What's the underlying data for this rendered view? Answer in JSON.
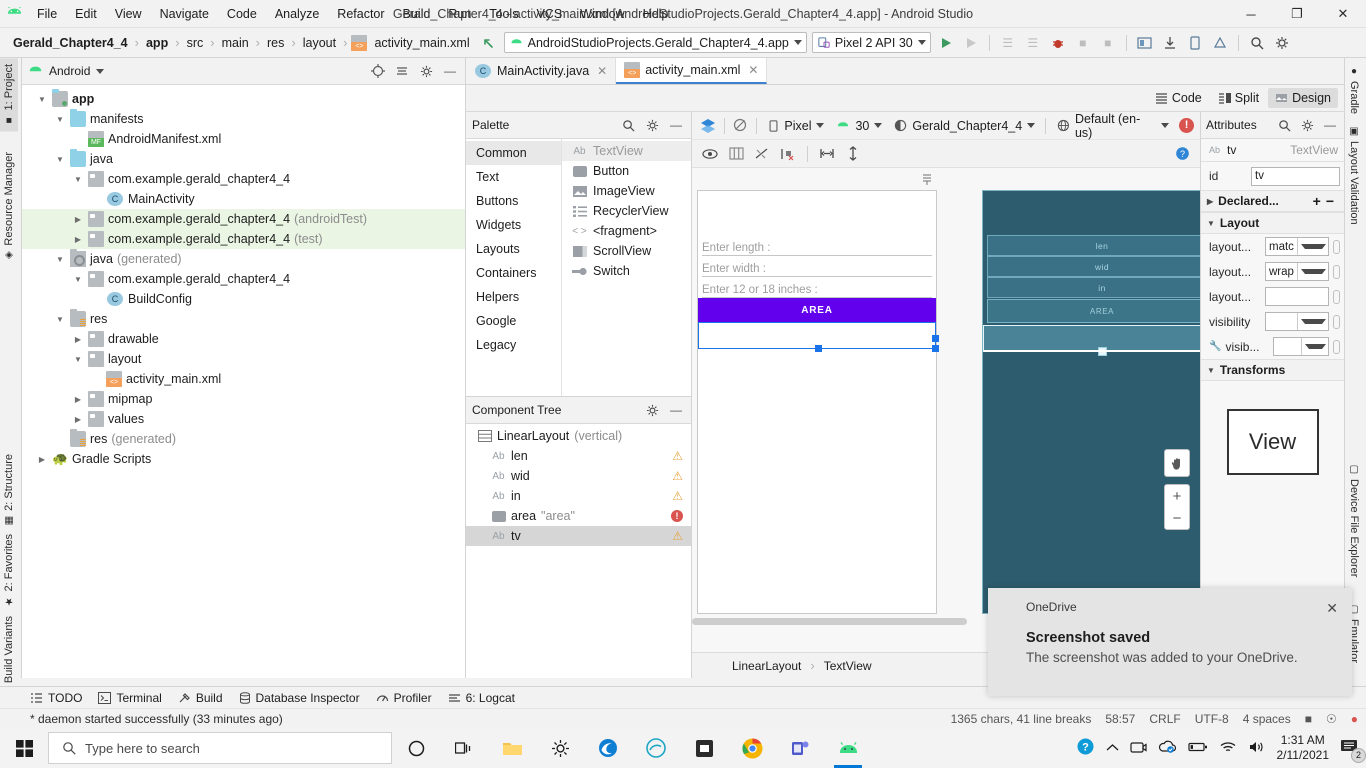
{
  "window": {
    "title": "Gerald_Chapter4_4 - activity_main.xml [AndroidStudioProjects.Gerald_Chapter4_4.app] - Android Studio",
    "minimize": "─",
    "maximize": "❐",
    "close": "✕"
  },
  "menubar": {
    "logo_icon": "android-logo",
    "items": [
      "File",
      "Edit",
      "View",
      "Navigate",
      "Code",
      "Analyze",
      "Refactor",
      "Build",
      "Run",
      "Tools",
      "VCS",
      "Window",
      "Help"
    ]
  },
  "breadcrumb": {
    "items": [
      "Gerald_Chapter4_4",
      "app",
      "src",
      "main",
      "res",
      "layout",
      "activity_main.xml"
    ],
    "separator": "›"
  },
  "toolbar": {
    "back_icon": "back-arrow-icon",
    "module_config": "AndroidStudioProjects.Gerald_Chapter4_4.app",
    "device_config": "Pixel 2 API 30",
    "run_icon": "run-icon",
    "debug_icon": "debug-icon",
    "icons": [
      "run-icon",
      "rerun-icon",
      "step-over-icon",
      "step-into-icon",
      "bug-icon",
      "stop-icon",
      "layout-inspector-icon",
      "apply-changes-icon",
      "avd-manager-icon",
      "sdk-manager-icon",
      "profiler-icon",
      "search-icon",
      "settings-icon"
    ]
  },
  "left_strip": {
    "tabs": [
      {
        "label": "1: Project",
        "icon": "project-icon",
        "active": true
      },
      {
        "label": "Resource Manager",
        "icon": "resource-icon",
        "active": false
      }
    ],
    "bottom_tabs": [
      {
        "label": "2: Structure",
        "icon": "structure-icon"
      },
      {
        "label": "2: Favorites",
        "icon": "star-icon"
      },
      {
        "label": "Build Variants",
        "icon": "android-icon"
      }
    ]
  },
  "right_strip": {
    "tabs": [
      {
        "label": "Gradle",
        "icon": "gradle-icon"
      },
      {
        "label": "Layout Validation",
        "icon": "layout-validation-icon"
      },
      {
        "label": "Device File Explorer",
        "icon": "device-file-icon"
      },
      {
        "label": "Emulator",
        "icon": "emulator-icon"
      }
    ]
  },
  "project_panel": {
    "title": "Android",
    "dropdown_icon": "chevron-down-icon",
    "header_icons": [
      "target-icon",
      "collapse-all-icon",
      "settings-icon",
      "minimize-icon"
    ],
    "tree": [
      {
        "depth": 0,
        "arrow": "open",
        "icon": "folder-app",
        "label": "app",
        "bold": true,
        "dim": "",
        "highlight": false
      },
      {
        "depth": 1,
        "arrow": "open",
        "icon": "folder-blue",
        "label": "manifests",
        "bold": false,
        "dim": "",
        "highlight": false
      },
      {
        "depth": 2,
        "arrow": "none",
        "icon": "manifest-file",
        "label": "AndroidManifest.xml",
        "bold": false,
        "dim": "",
        "highlight": false
      },
      {
        "depth": 1,
        "arrow": "open",
        "icon": "folder-blue",
        "label": "java",
        "bold": false,
        "dim": "",
        "highlight": false
      },
      {
        "depth": 2,
        "arrow": "open",
        "icon": "package",
        "label": "com.example.gerald_chapter4_4",
        "bold": false,
        "dim": "",
        "highlight": false
      },
      {
        "depth": 3,
        "arrow": "none",
        "icon": "class",
        "label": "MainActivity",
        "bold": false,
        "dim": "",
        "highlight": false
      },
      {
        "depth": 2,
        "arrow": "closed",
        "icon": "package",
        "label": "com.example.gerald_chapter4_4",
        "bold": false,
        "dim": "(androidTest)",
        "highlight": true
      },
      {
        "depth": 2,
        "arrow": "closed",
        "icon": "package",
        "label": "com.example.gerald_chapter4_4",
        "bold": false,
        "dim": "(test)",
        "highlight": true
      },
      {
        "depth": 1,
        "arrow": "open",
        "icon": "folder-generated",
        "label": "java",
        "bold": false,
        "dim": "(generated)",
        "highlight": false
      },
      {
        "depth": 2,
        "arrow": "open",
        "icon": "package",
        "label": "com.example.gerald_chapter4_4",
        "bold": false,
        "dim": "",
        "highlight": false
      },
      {
        "depth": 3,
        "arrow": "none",
        "icon": "class",
        "label": "BuildConfig",
        "bold": false,
        "dim": "",
        "highlight": false
      },
      {
        "depth": 1,
        "arrow": "open",
        "icon": "folder-res",
        "label": "res",
        "bold": false,
        "dim": "",
        "highlight": false
      },
      {
        "depth": 2,
        "arrow": "closed",
        "icon": "package",
        "label": "drawable",
        "bold": false,
        "dim": "",
        "highlight": false
      },
      {
        "depth": 2,
        "arrow": "open",
        "icon": "package",
        "label": "layout",
        "bold": false,
        "dim": "",
        "highlight": false
      },
      {
        "depth": 3,
        "arrow": "none",
        "icon": "xml-file",
        "label": "activity_main.xml",
        "bold": false,
        "dim": "",
        "highlight": false
      },
      {
        "depth": 2,
        "arrow": "closed",
        "icon": "package",
        "label": "mipmap",
        "bold": false,
        "dim": "",
        "highlight": false
      },
      {
        "depth": 2,
        "arrow": "closed",
        "icon": "package",
        "label": "values",
        "bold": false,
        "dim": "",
        "highlight": false
      },
      {
        "depth": 1,
        "arrow": "none",
        "icon": "folder-res",
        "label": "res",
        "bold": false,
        "dim": "(generated)",
        "highlight": false
      },
      {
        "depth": 0,
        "arrow": "closed",
        "icon": "gradle",
        "label": "Gradle Scripts",
        "bold": false,
        "dim": "",
        "highlight": false
      }
    ]
  },
  "editor": {
    "tabs": [
      {
        "label": "MainActivity.java",
        "icon": "java-class-icon",
        "active": false,
        "close": "✕"
      },
      {
        "label": "activity_main.xml",
        "icon": "xml-layout-icon",
        "active": true,
        "close": "✕"
      }
    ],
    "modes": [
      {
        "label": "Code",
        "icon": "code-icon",
        "active": false
      },
      {
        "label": "Split",
        "icon": "split-icon",
        "active": false
      },
      {
        "label": "Design",
        "icon": "design-icon",
        "active": true
      }
    ]
  },
  "palette": {
    "title": "Palette",
    "header_icons": [
      "search-icon",
      "settings-icon",
      "minimize-icon"
    ],
    "categories": [
      "Common",
      "Text",
      "Buttons",
      "Widgets",
      "Layouts",
      "Containers",
      "Helpers",
      "Google",
      "Legacy"
    ],
    "selected_category": "Common",
    "items": [
      {
        "label": "TextView",
        "icon": "textview-icon",
        "selected": true
      },
      {
        "label": "Button",
        "icon": "button-icon",
        "selected": false
      },
      {
        "label": "ImageView",
        "icon": "imageview-icon",
        "selected": false
      },
      {
        "label": "RecyclerView",
        "icon": "recyclerview-icon",
        "selected": false
      },
      {
        "label": "<fragment>",
        "icon": "fragment-icon",
        "selected": false
      },
      {
        "label": "ScrollView",
        "icon": "scrollview-icon",
        "selected": false
      },
      {
        "label": "Switch",
        "icon": "switch-icon",
        "selected": false
      }
    ]
  },
  "component_tree": {
    "title": "Component Tree",
    "header_icons": [
      "settings-icon",
      "minimize-icon"
    ],
    "rows": [
      {
        "label": "LinearLayout",
        "sub": "(vertical)",
        "icon": "linearlayout-icon",
        "status": "none",
        "selected": false
      },
      {
        "label": "len",
        "sub": "",
        "icon": "textview-icon",
        "status": "warning",
        "selected": false
      },
      {
        "label": "wid",
        "sub": "",
        "icon": "textview-icon",
        "status": "warning",
        "selected": false
      },
      {
        "label": "in",
        "sub": "",
        "icon": "textview-icon",
        "status": "warning",
        "selected": false
      },
      {
        "label": "area",
        "sub": "\"area\"",
        "icon": "button-icon",
        "status": "error",
        "selected": false
      },
      {
        "label": "tv",
        "sub": "",
        "icon": "textview-icon",
        "status": "warning",
        "selected": true
      }
    ]
  },
  "design_surface": {
    "toolbar_icons": [
      "design-blueprint-icon",
      "orientation-icon"
    ],
    "device": "Pixel",
    "api_level": "30",
    "theme": "Gerald_Chapter4_4",
    "locale": "Default (en-us)",
    "error_icon": "error-icon",
    "help_icon": "help-icon",
    "hamburger_icon": "hamburger-icon",
    "view_icons": [
      "eye-icon",
      "columns-icon",
      "no-constraints-icon",
      "clear-constraints-icon",
      "pack-icon",
      "baseline-align-icon"
    ],
    "pan_icon": "pan-hand-icon",
    "zoom_in": "+",
    "zoom_out": "−",
    "preview": {
      "fields": [
        "Enter length :",
        "Enter width :",
        "Enter 12 or 18 inches :"
      ],
      "button": "AREA",
      "selected_widget": "tv"
    },
    "blueprint": {
      "rows": [
        "len",
        "wid",
        "in"
      ],
      "button": "AREA"
    },
    "breadcrumb": [
      "LinearLayout",
      "TextView"
    ],
    "breadcrumb_sep": "›"
  },
  "attributes": {
    "title": "Attributes",
    "header_icons": [
      "search-icon",
      "settings-icon",
      "minimize-icon"
    ],
    "component_id": "tv",
    "component_type": "TextView",
    "component_icon": "textview-icon",
    "id_label": "id",
    "id_value": "tv",
    "declared_label": "Declared...",
    "add_icon": "+",
    "remove_icon": "−",
    "layout_section": "Layout",
    "transforms_section": "Transforms",
    "rows": [
      {
        "label": "layout...",
        "value": "matс",
        "type": "select",
        "wrench": false
      },
      {
        "label": "layout...",
        "value": "wrap",
        "type": "select",
        "wrench": false
      },
      {
        "label": "layout...",
        "value": "",
        "type": "input",
        "wrench": false
      },
      {
        "label": "visibility",
        "value": "",
        "type": "select",
        "wrench": false
      },
      {
        "label": "visib...",
        "value": "",
        "type": "select",
        "wrench": true
      }
    ],
    "view_preview_label": "View"
  },
  "tool_windows": [
    {
      "label": "TODO",
      "icon": "todo-icon"
    },
    {
      "label": "Terminal",
      "icon": "terminal-icon"
    },
    {
      "label": "Build",
      "icon": "build-hammer-icon"
    },
    {
      "label": "Database Inspector",
      "icon": "database-icon"
    },
    {
      "label": "Profiler",
      "icon": "profiler-icon"
    },
    {
      "label": "6: Logcat",
      "icon": "logcat-icon"
    }
  ],
  "status_bar": {
    "message": "* daemon started successfully (33 minutes ago)",
    "chars": "1365 chars, 41 line breaks",
    "position": "58:57",
    "line_sep": "CRLF",
    "encoding": "UTF-8",
    "indent": "4 spaces",
    "icons": [
      "lock-icon",
      "inspection-icon",
      "notification-icon"
    ]
  },
  "toast": {
    "app": "OneDrive",
    "close": "✕",
    "title": "Screenshot saved",
    "body": "The screenshot was added to your OneDrive."
  },
  "taskbar": {
    "start_icon": "windows-start-icon",
    "search_placeholder": "Type here to search",
    "search_icon": "search-icon",
    "pinned": [
      {
        "icon": "cortana-icon",
        "active": false
      },
      {
        "icon": "task-view-icon",
        "active": false
      },
      {
        "icon": "file-explorer-icon",
        "active": false
      },
      {
        "icon": "settings-gear-icon",
        "active": false
      },
      {
        "icon": "edge-icon",
        "active": false
      },
      {
        "icon": "edge-legacy-icon",
        "active": false
      },
      {
        "icon": "store-icon",
        "active": false
      },
      {
        "icon": "chrome-icon",
        "active": false
      },
      {
        "icon": "teams-icon",
        "active": false
      },
      {
        "icon": "android-studio-icon",
        "active": true
      }
    ],
    "tray": [
      "help-icon",
      "chevron-up-icon",
      "camera-icon",
      "onedrive-icon",
      "battery-icon",
      "wifi-icon",
      "volume-icon"
    ],
    "time": "1:31 AM",
    "date": "2/11/2021",
    "notification_count": "2",
    "notification_icon": "notification-icon"
  }
}
